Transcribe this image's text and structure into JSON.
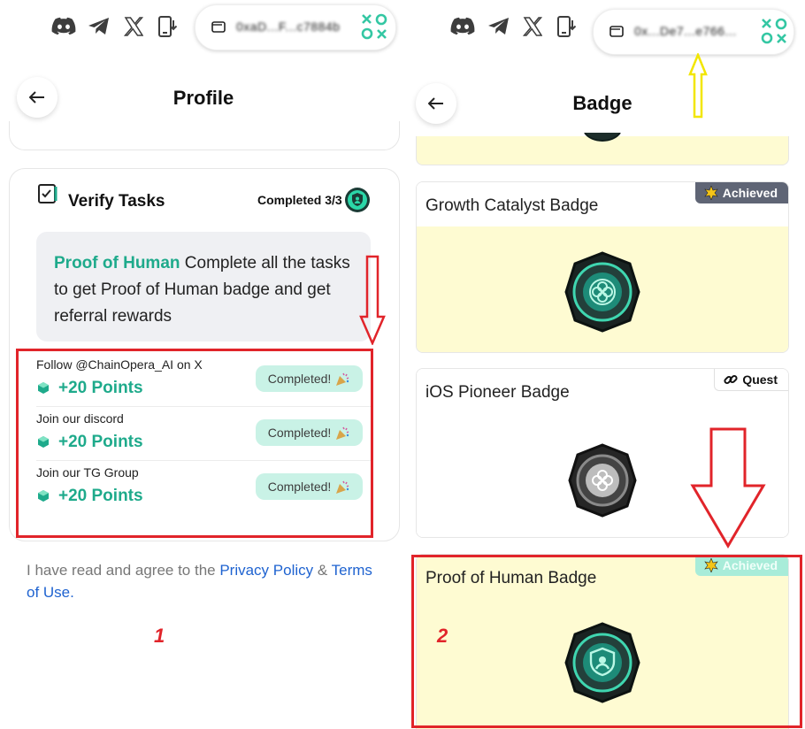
{
  "left": {
    "wallet_address": "0xaD...F...c7884b",
    "page_title": "Profile",
    "tasks_card": {
      "title": "Verify Tasks",
      "progress": "Completed 3/3",
      "proof_heading": "Proof of Human",
      "proof_text": " Complete all the tasks to get Proof of Human badge and get referral rewards",
      "tasks": [
        {
          "label": "Follow @ChainOpera_AI on X",
          "points": "+20 Points",
          "status": "Completed!"
        },
        {
          "label": "Join our discord",
          "points": "+20 Points",
          "status": "Completed!"
        },
        {
          "label": "Join our TG Group",
          "points": "+20 Points",
          "status": "Completed!"
        }
      ]
    },
    "agreement": {
      "prefix": "I have read and agree to the ",
      "privacy_link": "Privacy Policy",
      "amp": " & ",
      "terms_link": "Terms of Use",
      "suffix": "."
    },
    "annotation_number": "1"
  },
  "right": {
    "wallet_address": "0x...De7...e766...",
    "page_title": "Badge",
    "badges": [
      {
        "name": "Growth Catalyst Badge",
        "status": "Achieved"
      },
      {
        "name": "iOS Pioneer Badge",
        "status": "Quest"
      },
      {
        "name": "Proof of Human Badge",
        "status": "Achieved"
      }
    ],
    "annotation_number": "2"
  },
  "icons": {
    "social": [
      "discord-icon",
      "telegram-icon",
      "x-icon",
      "app-download-icon"
    ],
    "brand": "xoxo-logo"
  },
  "colors": {
    "accent_teal": "#1eaa8b",
    "annotation_red": "#e1242a",
    "annotation_yellow": "#f2e600",
    "badge_bg": "#fefbd2",
    "link_blue": "#1f63d0"
  }
}
